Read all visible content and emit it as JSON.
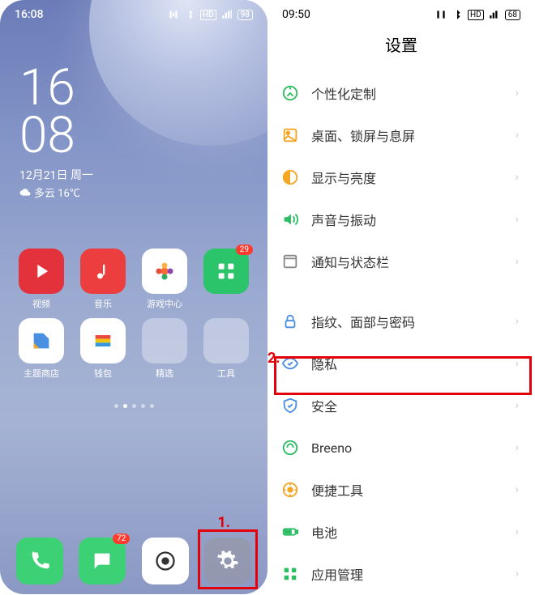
{
  "left": {
    "status_time": "16:08",
    "battery": "98",
    "clock_h": "16",
    "clock_m": "08",
    "date": "12月21日 周一",
    "weather": "多云 16℃",
    "apps_r1": [
      {
        "label": "视频",
        "badge": null
      },
      {
        "label": "音乐",
        "badge": null
      },
      {
        "label": "游戏中心",
        "badge": null
      },
      {
        "label": "",
        "badge": "29"
      }
    ],
    "apps_r2": [
      {
        "label": "主题商店",
        "badge": null
      },
      {
        "label": "钱包",
        "badge": null
      },
      {
        "label": "精选",
        "badge": null
      },
      {
        "label": "工具",
        "badge": null
      }
    ],
    "dock_msg_badge": "72",
    "step1_label": "1."
  },
  "right": {
    "status_time": "09:50",
    "battery": "68",
    "title": "设置",
    "step2_label": "2.",
    "group1": [
      {
        "label": "个性化定制",
        "icon": "compass",
        "color": "#2dbd62"
      },
      {
        "label": "桌面、锁屏与息屏",
        "icon": "picture",
        "color": "#f5a623"
      },
      {
        "label": "显示与亮度",
        "icon": "contrast",
        "color": "#f5a623"
      },
      {
        "label": "声音与振动",
        "icon": "sound",
        "color": "#2dbd62"
      },
      {
        "label": "通知与状态栏",
        "icon": "notify",
        "color": "#888"
      }
    ],
    "group2": [
      {
        "label": "指纹、面部与密码",
        "icon": "lock",
        "color": "#4a90e2"
      },
      {
        "label": "隐私",
        "icon": "privacy",
        "color": "#4a90e2"
      },
      {
        "label": "安全",
        "icon": "shield",
        "color": "#4a90e2"
      },
      {
        "label": "Breeno",
        "icon": "breeno",
        "color": "#2dbd62"
      },
      {
        "label": "便捷工具",
        "icon": "tool",
        "color": "#f5a623"
      },
      {
        "label": "电池",
        "icon": "battery",
        "color": "#2dbd62"
      },
      {
        "label": "应用管理",
        "icon": "apps",
        "color": "#2dbd62"
      }
    ]
  }
}
